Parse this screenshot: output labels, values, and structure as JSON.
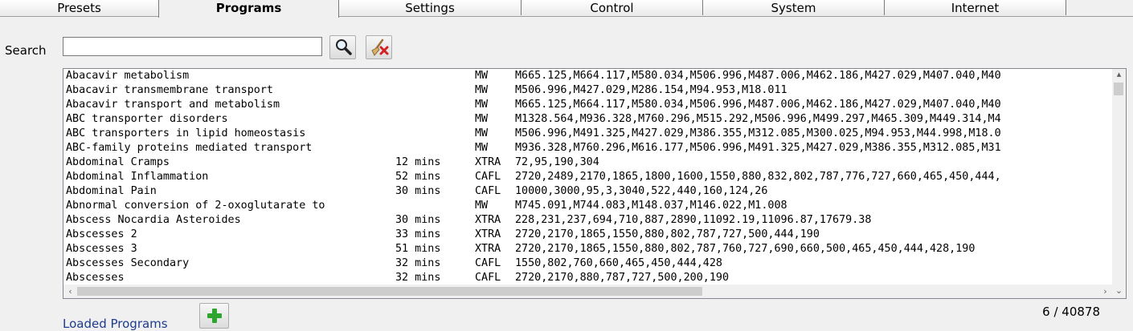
{
  "tabs": [
    {
      "label": "Presets",
      "active": false
    },
    {
      "label": "Programs",
      "active": true
    },
    {
      "label": "Settings",
      "active": false
    },
    {
      "label": "Control",
      "active": false
    },
    {
      "label": "System",
      "active": false
    },
    {
      "label": "Internet",
      "active": false
    }
  ],
  "search": {
    "label": "Search",
    "value": "",
    "placeholder": ""
  },
  "icons": {
    "search_button": "magnifier-icon",
    "clear_button": "broom-clear-icon",
    "add_button": "plus-icon"
  },
  "colors": {
    "add_green": "#2fa52f",
    "link_blue": "#1d3c8f",
    "clear_red": "#d42020"
  },
  "programs": [
    {
      "name": "Abacavir metabolism",
      "duration": "",
      "type": "MW",
      "frequencies": "M665.125,M664.117,M580.034,M506.996,M487.006,M462.186,M427.029,M407.040,M40"
    },
    {
      "name": "Abacavir transmembrane transport",
      "duration": "",
      "type": "MW",
      "frequencies": "M506.996,M427.029,M286.154,M94.953,M18.011"
    },
    {
      "name": "Abacavir transport and metabolism",
      "duration": "",
      "type": "MW",
      "frequencies": "M665.125,M664.117,M580.034,M506.996,M487.006,M462.186,M427.029,M407.040,M40"
    },
    {
      "name": "ABC transporter disorders",
      "duration": "",
      "type": "MW",
      "frequencies": "M1328.564,M936.328,M760.296,M515.292,M506.996,M499.297,M465.309,M449.314,M4"
    },
    {
      "name": "ABC transporters in lipid homeostasis",
      "duration": "",
      "type": "MW",
      "frequencies": "M506.996,M491.325,M427.029,M386.355,M312.085,M300.025,M94.953,M44.998,M18.0"
    },
    {
      "name": "ABC-family proteins mediated transport",
      "duration": "",
      "type": "MW",
      "frequencies": "M936.328,M760.296,M616.177,M506.996,M491.325,M427.029,M386.355,M312.085,M31"
    },
    {
      "name": "Abdominal Cramps",
      "duration": "12 mins",
      "type": "XTRA",
      "frequencies": "72,95,190,304"
    },
    {
      "name": "Abdominal Inflammation",
      "duration": "52 mins",
      "type": "CAFL",
      "frequencies": "2720,2489,2170,1865,1800,1600,1550,880,832,802,787,776,727,660,465,450,444,"
    },
    {
      "name": "Abdominal Pain",
      "duration": "30 mins",
      "type": "CAFL",
      "frequencies": "10000,3000,95,3,3040,522,440,160,124,26"
    },
    {
      "name": "Abnormal conversion of 2-oxoglutarate to",
      "duration": "",
      "type": "MW",
      "frequencies": "M745.091,M744.083,M148.037,M146.022,M1.008"
    },
    {
      "name": "Abscess Nocardia Asteroides",
      "duration": "30 mins",
      "type": "XTRA",
      "frequencies": "228,231,237,694,710,887,2890,11092.19,11096.87,17679.38"
    },
    {
      "name": "Abscesses 2",
      "duration": "33 mins",
      "type": "XTRA",
      "frequencies": "2720,2170,1865,1550,880,802,787,727,500,444,190"
    },
    {
      "name": "Abscesses 3",
      "duration": "51 mins",
      "type": "XTRA",
      "frequencies": "2720,2170,1865,1550,880,802,787,760,727,690,660,500,465,450,444,428,190"
    },
    {
      "name": "Abscesses Secondary",
      "duration": "32 mins",
      "type": "CAFL",
      "frequencies": "1550,802,760,660,465,450,444,428"
    },
    {
      "name": "Abscesses",
      "duration": "32 mins",
      "type": "CAFL",
      "frequencies": "2720,2170,880,787,727,500,200,190"
    }
  ],
  "footer": {
    "loaded_link": "Loaded Programs",
    "count": "6 / 40878"
  }
}
